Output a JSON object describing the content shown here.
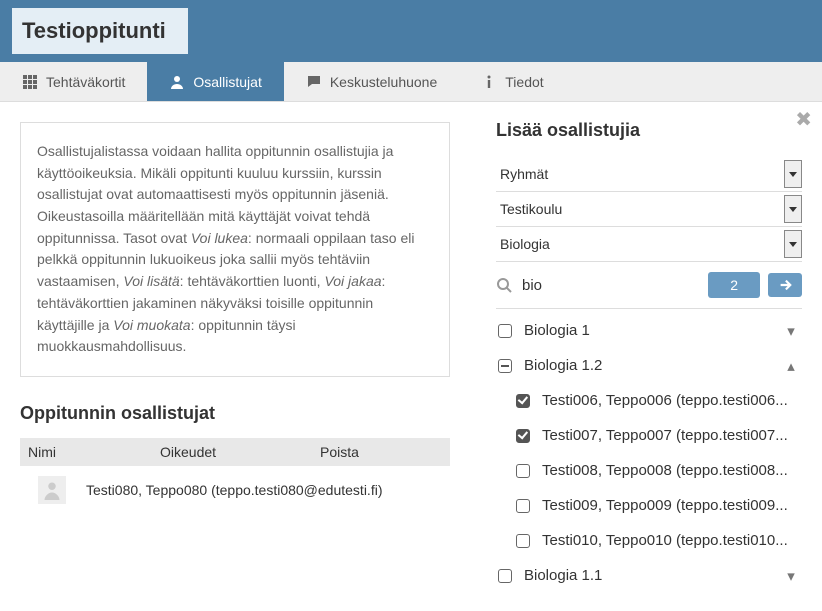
{
  "header": {
    "title": "Testioppitunti"
  },
  "tabs": {
    "tasks": "Tehtäväkortit",
    "participants": "Osallistujat",
    "chat": "Keskusteluhuone",
    "info": "Tiedot"
  },
  "intro_html": "Osallistujalistassa voidaan hallita oppitunnin osallistujia ja käyttöoikeuksia. Mikäli oppitunti kuuluu kurssiin, kurssin osallistujat ovat automaattisesti myös oppitunnin jäseniä. Oikeustasoilla määritellään mitä käyttäjät voivat tehdä oppitunnissa. Tasot ovat <em>Voi lukea</em>: normaali oppilaan taso eli pelkkä oppitunnin lukuoikeus joka sallii myös tehtäviin vastaamisen, <em>Voi lisätä</em>: tehtäväkorttien luonti, <em>Voi jakaa</em>: tehtäväkorttien jakaminen näkyväksi toisille oppitunnin käyttäjille ja <em>Voi muokata</em>: oppitunnin täysi muokkausmahdollisuus.",
  "left": {
    "heading": "Oppitunnin osallistujat",
    "cols": {
      "name": "Nimi",
      "rights": "Oikeudet",
      "remove": "Poista"
    },
    "rows": [
      {
        "label": "Testi080, Teppo080 (teppo.testi080@edutesti.fi)"
      }
    ]
  },
  "right": {
    "heading": "Lisää osallistujia",
    "selects": {
      "groups": "Ryhmät",
      "school": "Testikoulu",
      "subject": "Biologia"
    },
    "search": {
      "query": "bio",
      "count": "2"
    },
    "tree": [
      {
        "type": "group",
        "label": "Biologia 1",
        "state": "collapsed",
        "checked": "empty"
      },
      {
        "type": "group",
        "label": "Biologia 1.2",
        "state": "expanded",
        "checked": "minus",
        "children": [
          {
            "label": "Testi006, Teppo006 (teppo.testi006...",
            "checked": true
          },
          {
            "label": "Testi007, Teppo007 (teppo.testi007...",
            "checked": true
          },
          {
            "label": "Testi008, Teppo008 (teppo.testi008...",
            "checked": false
          },
          {
            "label": "Testi009, Teppo009 (teppo.testi009...",
            "checked": false
          },
          {
            "label": "Testi010, Teppo010 (teppo.testi010...",
            "checked": false
          }
        ]
      },
      {
        "type": "group",
        "label": "Biologia 1.1",
        "state": "collapsed",
        "checked": "empty"
      }
    ]
  }
}
